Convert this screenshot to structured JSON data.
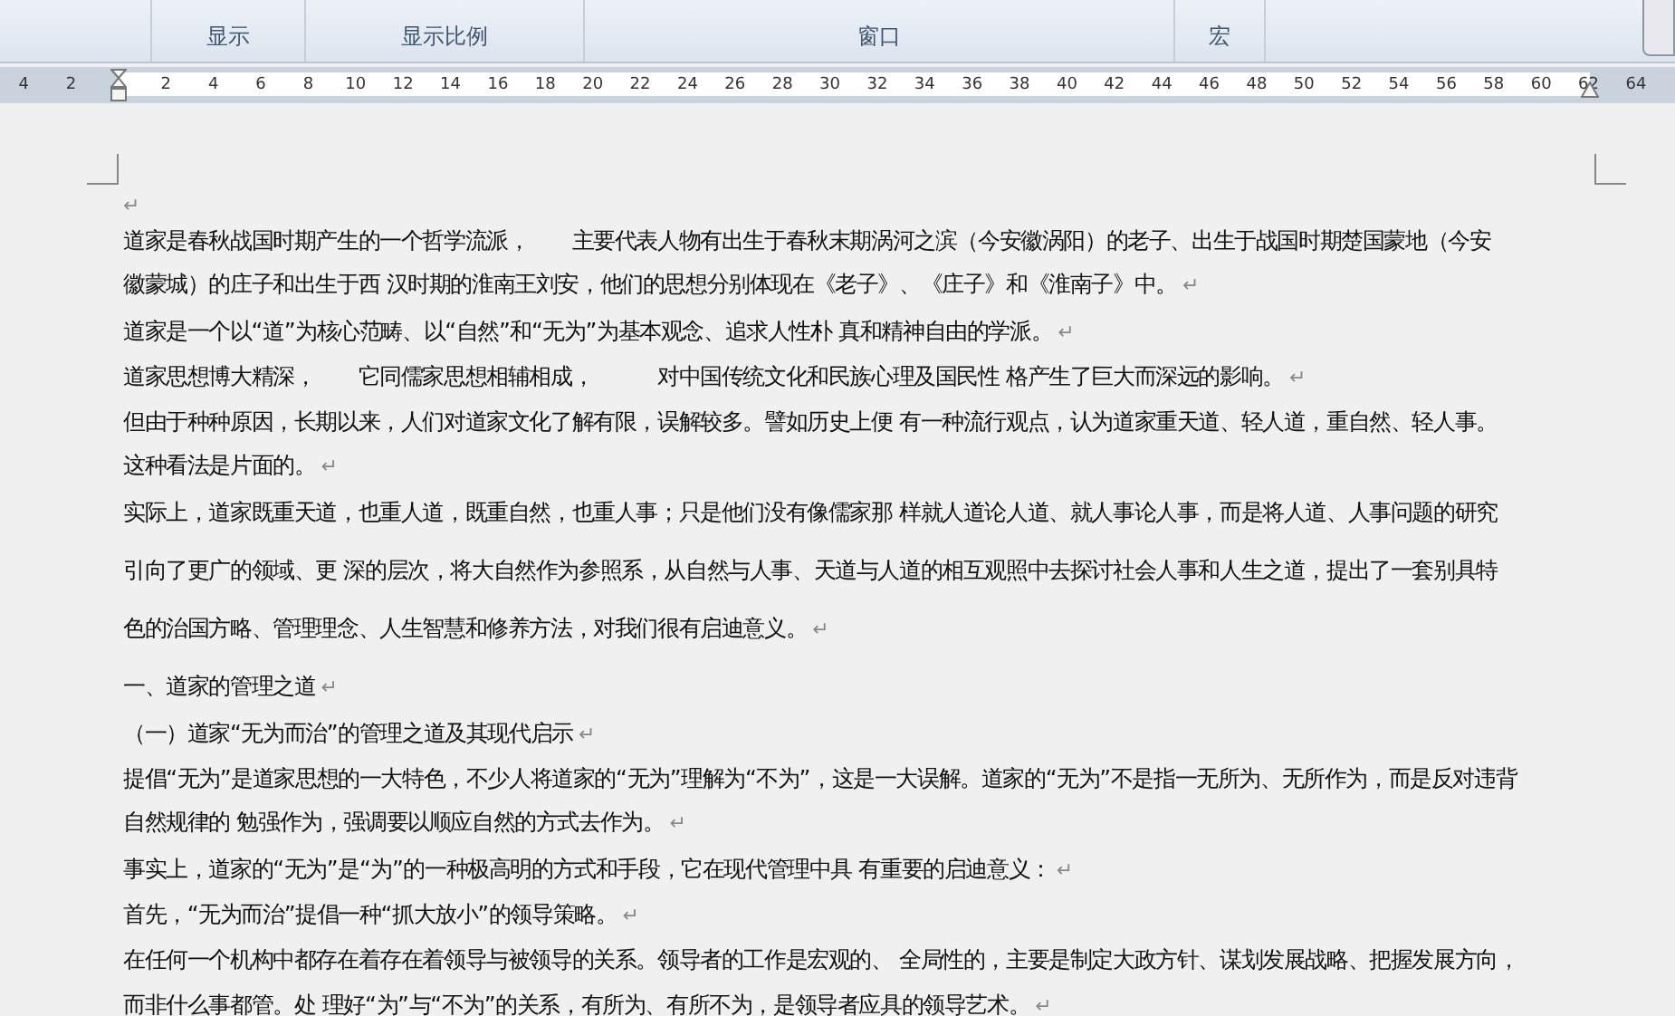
{
  "ribbon": {
    "groups": [
      {
        "label": "显示"
      },
      {
        "label": "显示比例"
      },
      {
        "label": "窗口"
      },
      {
        "label": "宏"
      }
    ]
  },
  "ruler": {
    "left_numbers": [
      "4",
      "2"
    ],
    "right_numbers": [
      "2",
      "4",
      "6",
      "8",
      "10",
      "12",
      "14",
      "16",
      "18",
      "20",
      "22",
      "24",
      "26",
      "28",
      "30",
      "32",
      "34",
      "36",
      "38",
      "40",
      "42",
      "44",
      "46",
      "48",
      "50",
      "52",
      "54",
      "56",
      "58",
      "60",
      "62",
      "64"
    ]
  },
  "document": {
    "empty_mark": "↵",
    "paragraphs": [
      {
        "lines": [
          "道家是春秋战国时期产生的一个哲学流派，　　主要代表人物有出生于春秋末期涡河之滨（今安徽涡阳）的老子、出生于战国时期楚国蒙地（今安",
          "徽蒙城）的庄子和出生于西 汉时期的淮南王刘安，他们的思想分别体现在《老子》、《庄子》和《淮南子》中。"
        ],
        "mark": "↵"
      },
      {
        "lines": [
          "道家是一个以“道”为核心范畴、以“自然”和“无为”为基本观念、追求人性朴 真和精神自由的学派。"
        ],
        "mark": "↵"
      },
      {
        "lines": [
          "道家思想博大精深，　　它同儒家思想相辅相成，　　　对中国传统文化和民族心理及国民性 格产生了巨大而深远的影响。"
        ],
        "mark": "↵"
      },
      {
        "lines": [
          "但由于种种原因，长期以来，人们对道家文化了解有限，误解较多。譬如历史上便 有一种流行观点，认为道家重天道、轻人道，重自然、轻人事。",
          "这种看法是片面的。"
        ],
        "mark": "↵"
      },
      {
        "lines": [
          "实际上，道家既重天道，也重人道，既重自然，也重人事；只是他们没有像儒家那 样就人道论人道、就人事论人事，而是将人道、人事问题的研究",
          "引向了更广的领域、更 深的层次，将大自然作为参照系，从自然与人事、天道与人道的相互观照中去探讨社会人事和人生之道，提出了一套别具特",
          "色的治国方略、管理理念、人生智慧和修养方法，对我们很有启迪意义。"
        ],
        "mark": "↵"
      },
      {
        "lines": [
          "一、道家的管理之道"
        ],
        "mark": "↵"
      },
      {
        "lines": [
          "（一）道家“无为而治”的管理之道及其现代启示"
        ],
        "mark": "↵"
      },
      {
        "lines": [
          "提倡“无为”是道家思想的一大特色，不少人将道家的“无为”理解为“不为”，这是一大误解。道家的“无为”不是指一无所为、无所作为，而是反对违背",
          "自然规律的 勉强作为，强调要以顺应自然的方式去作为。"
        ],
        "mark": "↵"
      },
      {
        "lines": [
          "事实上，道家的“无为”是“为”的一种极高明的方式和手段，它在现代管理中具 有重要的启迪意义："
        ],
        "mark": "↵"
      },
      {
        "lines": [
          "首先，“无为而治”提倡一种“抓大放小”的领导策略。"
        ],
        "mark": "↵"
      },
      {
        "lines": [
          "在任何一个机构中都存在着存在着领导与被领导的关系。领导者的工作是宏观的、 全局性的，主要是制定大政方针、谋划发展战略、把握发展方向，",
          "而非什么事都管。处 理好“为”与“不为”的关系，有所为、有所不为，是领导者应具的领导艺术。"
        ],
        "mark": "↵"
      }
    ]
  }
}
